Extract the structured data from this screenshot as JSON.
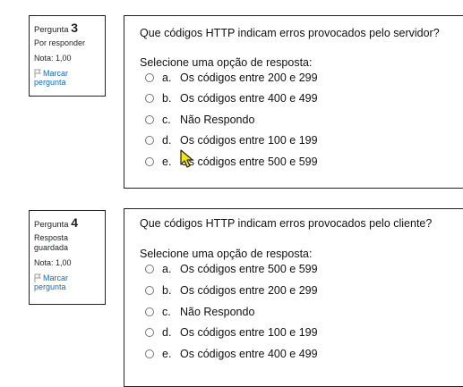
{
  "q3": {
    "label": "Pergunta",
    "number": "3",
    "state": "Por responder",
    "grade": "Nota: 1,00",
    "flag_line1": "Marcar",
    "flag_line2": "pergunta",
    "text": "Que códigos HTTP indicam erros provocados pelo servidor?",
    "prompt": "Selecione uma opção de resposta:",
    "options": [
      {
        "letter": "a.",
        "text": "Os códigos entre 200 e 299"
      },
      {
        "letter": "b.",
        "text": "Os códigos entre 400 e 499"
      },
      {
        "letter": "c.",
        "text": "Não Respondo"
      },
      {
        "letter": "d.",
        "text": "Os códigos entre 100 e 199"
      },
      {
        "letter": "e.",
        "text": "Os códigos entre 500 e 599"
      }
    ]
  },
  "q4": {
    "label": "Pergunta",
    "number": "4",
    "state_line1": "Resposta",
    "state_line2": "guardada",
    "grade": "Nota: 1,00",
    "flag_line1": "Marcar",
    "flag_line2": "pergunta",
    "text": "Que códigos HTTP indicam erros provocados pelo cliente?",
    "prompt": "Selecione uma opção de resposta:",
    "options": [
      {
        "letter": "a.",
        "text": "Os códigos entre 500 e 599"
      },
      {
        "letter": "b.",
        "text": "Os códigos entre 200 e 299"
      },
      {
        "letter": "c.",
        "text": "Não Respondo"
      },
      {
        "letter": "d.",
        "text": "Os códigos entre 100 e 199"
      },
      {
        "letter": "e.",
        "text": "Os códigos entre 400 e 499"
      }
    ]
  },
  "colors": {
    "link": "#0f6cbf",
    "border": "#222222",
    "cursor": "#f5e600"
  },
  "icons": {
    "flag": "flag-icon",
    "cursor": "mouse-pointer-icon"
  }
}
